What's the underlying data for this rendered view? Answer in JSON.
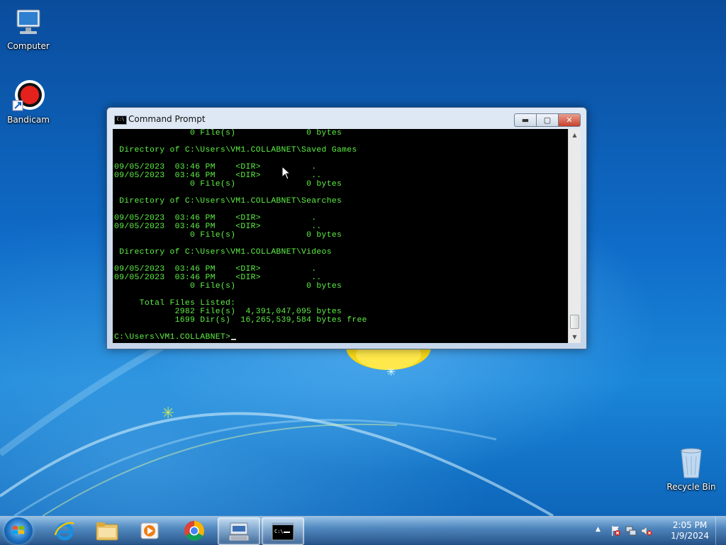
{
  "desktop": {
    "icons": [
      {
        "label": "Computer"
      },
      {
        "label": "Bandicam"
      },
      {
        "label": "Recycle Bin"
      }
    ]
  },
  "window": {
    "title": "Command Prompt",
    "buttons": {
      "minimize": "▬",
      "maximize": "▢",
      "close": "✕"
    },
    "console_lines": [
      "               0 File(s)              0 bytes",
      "",
      " Directory of C:\\Users\\VM1.COLLABNET\\Saved Games",
      "",
      "09/05/2023  03:46 PM    <DIR>          .",
      "09/05/2023  03:46 PM    <DIR>          ..",
      "               0 File(s)              0 bytes",
      "",
      " Directory of C:\\Users\\VM1.COLLABNET\\Searches",
      "",
      "09/05/2023  03:46 PM    <DIR>          .",
      "09/05/2023  03:46 PM    <DIR>          ..",
      "               0 File(s)              0 bytes",
      "",
      " Directory of C:\\Users\\VM1.COLLABNET\\Videos",
      "",
      "09/05/2023  03:46 PM    <DIR>          .",
      "09/05/2023  03:46 PM    <DIR>          ..",
      "               0 File(s)              0 bytes",
      "",
      "     Total Files Listed:",
      "            2982 File(s)  4,391,047,095 bytes",
      "            1699 Dir(s)  16,265,539,584 bytes free"
    ],
    "prompt": "C:\\Users\\VM1.COLLABNET>"
  },
  "taskbar": {
    "items": [
      {
        "icon": "start-orb-icon"
      },
      {
        "icon": "internet-explorer-icon"
      },
      {
        "icon": "file-explorer-icon"
      },
      {
        "icon": "media-player-icon"
      },
      {
        "icon": "chrome-icon"
      },
      {
        "icon": "on-screen-keyboard-icon"
      },
      {
        "icon": "command-prompt-icon"
      }
    ],
    "clock": {
      "time": "2:05 PM",
      "date": "1/9/2024"
    }
  }
}
